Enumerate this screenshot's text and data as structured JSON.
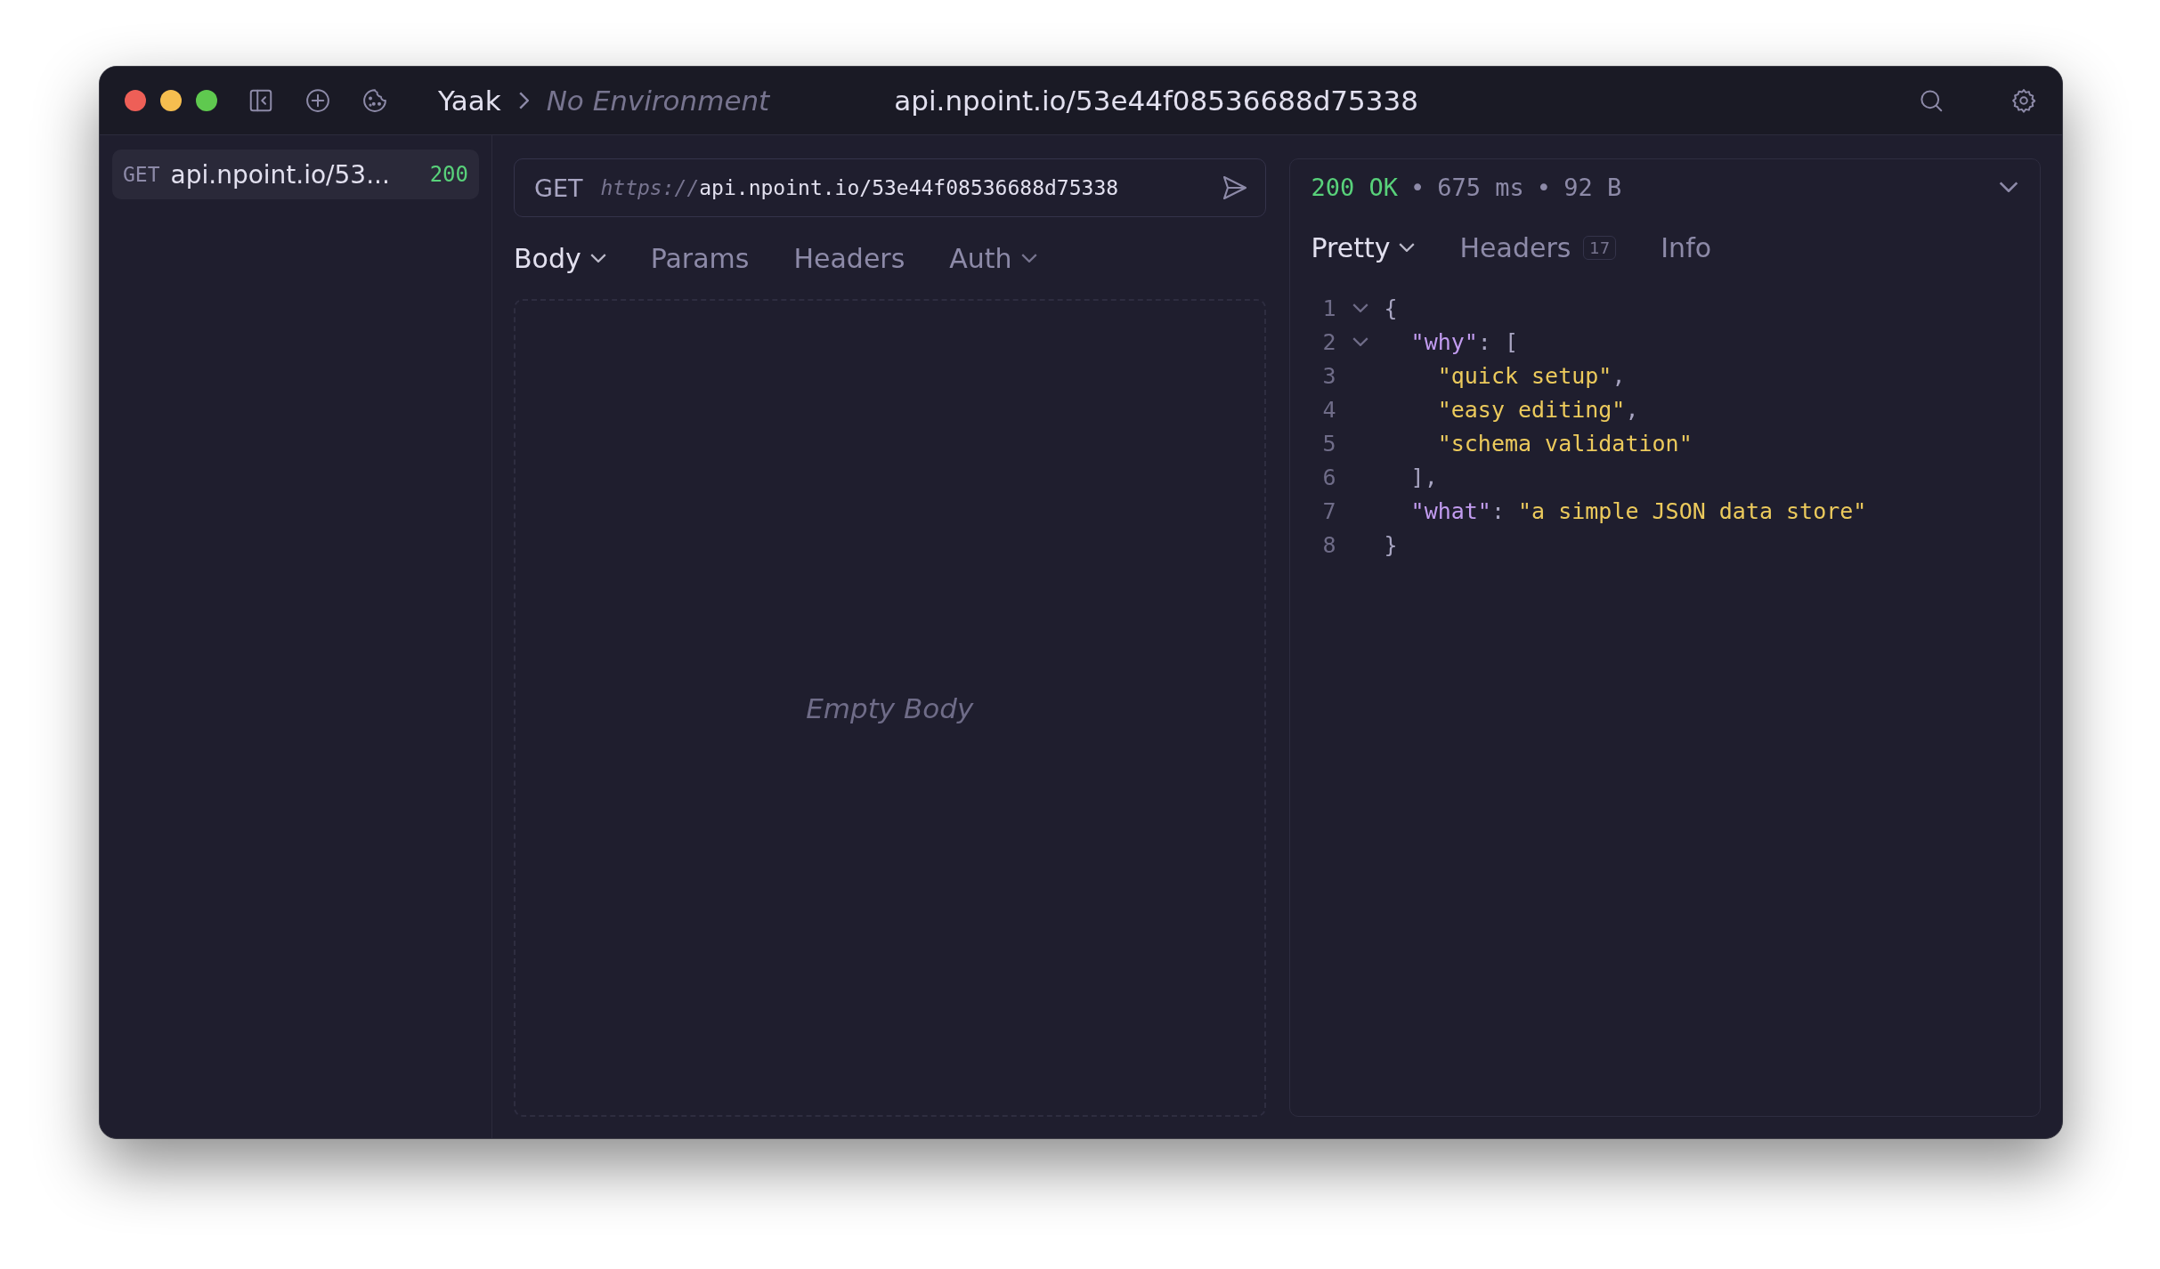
{
  "titlebar": {
    "workspace": "Yaak",
    "environment": "No Environment",
    "title": "api.npoint.io/53e44f08536688d75338"
  },
  "sidebar": {
    "items": [
      {
        "method": "GET",
        "name": "api.npoint.io/53...",
        "status": "200",
        "selected": true
      }
    ]
  },
  "request": {
    "method": "GET",
    "url_scheme": "https://",
    "url_rest": "api.npoint.io/53e44f08536688d75338",
    "tabs": [
      {
        "label": "Body",
        "selected": true,
        "dropdown": true
      },
      {
        "label": "Params",
        "selected": false,
        "dropdown": false
      },
      {
        "label": "Headers",
        "selected": false,
        "dropdown": false
      },
      {
        "label": "Auth",
        "selected": false,
        "dropdown": true
      }
    ],
    "empty_text": "Empty Body"
  },
  "response": {
    "status": "200 OK",
    "time": "675 ms",
    "size": "92 B",
    "separator": "•",
    "tabs": [
      {
        "label": "Pretty",
        "selected": true,
        "dropdown": true
      },
      {
        "label": "Headers",
        "selected": false,
        "dropdown": false,
        "count": "17"
      },
      {
        "label": "Info",
        "selected": false,
        "dropdown": false
      }
    ],
    "code": [
      {
        "number": "1",
        "foldable": true,
        "tokens": [
          {
            "kind": "punct",
            "text": "{"
          }
        ]
      },
      {
        "number": "2",
        "foldable": true,
        "tokens": [
          {
            "kind": "key",
            "text": "  \"why\""
          },
          {
            "kind": "punct",
            "text": ": ["
          }
        ]
      },
      {
        "number": "3",
        "foldable": false,
        "tokens": [
          {
            "kind": "string",
            "text": "    \"quick setup\""
          },
          {
            "kind": "punct",
            "text": ","
          }
        ]
      },
      {
        "number": "4",
        "foldable": false,
        "tokens": [
          {
            "kind": "string",
            "text": "    \"easy editing\""
          },
          {
            "kind": "punct",
            "text": ","
          }
        ]
      },
      {
        "number": "5",
        "foldable": false,
        "tokens": [
          {
            "kind": "string",
            "text": "    \"schema validation\""
          }
        ]
      },
      {
        "number": "6",
        "foldable": false,
        "tokens": [
          {
            "kind": "punct",
            "text": "  ],"
          }
        ]
      },
      {
        "number": "7",
        "foldable": false,
        "tokens": [
          {
            "kind": "key",
            "text": "  \"what\""
          },
          {
            "kind": "punct",
            "text": ": "
          },
          {
            "kind": "string",
            "text": "\"a simple JSON data store\""
          }
        ]
      },
      {
        "number": "8",
        "foldable": false,
        "tokens": [
          {
            "kind": "punct",
            "text": "}"
          }
        ]
      }
    ]
  }
}
